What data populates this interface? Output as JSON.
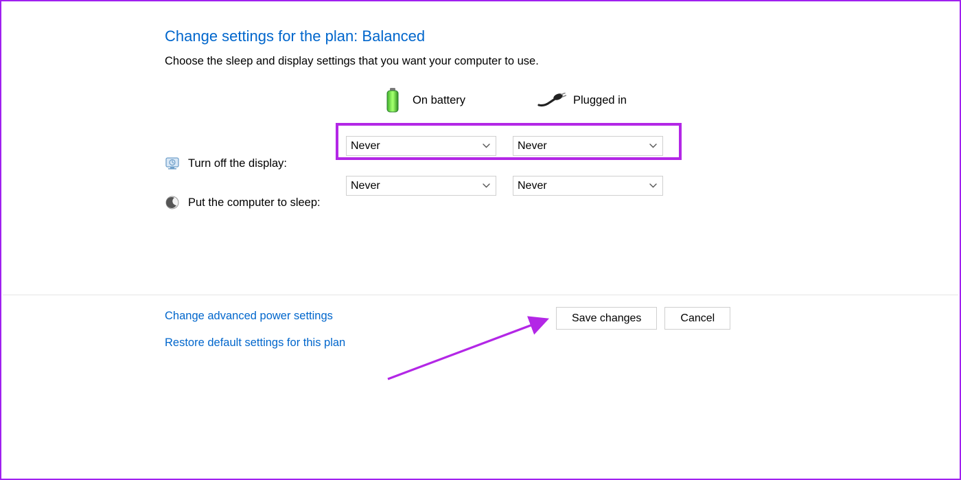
{
  "title": "Change settings for the plan: Balanced",
  "subtitle": "Choose the sleep and display settings that you want your computer to use.",
  "columns": {
    "battery": "On battery",
    "plugged": "Plugged in"
  },
  "rows": {
    "display": {
      "label": "Turn off the display:",
      "battery_value": "Never",
      "plugged_value": "Never"
    },
    "sleep": {
      "label": "Put the computer to sleep:",
      "battery_value": "Never",
      "plugged_value": "Never"
    }
  },
  "links": {
    "advanced": "Change advanced power settings",
    "restore": "Restore default settings for this plan"
  },
  "buttons": {
    "save": "Save changes",
    "cancel": "Cancel"
  },
  "icons": {
    "display": "display-icon",
    "sleep": "moon-icon",
    "battery": "battery-icon",
    "plug": "plug-icon",
    "chevron": "chevron-down-icon"
  }
}
